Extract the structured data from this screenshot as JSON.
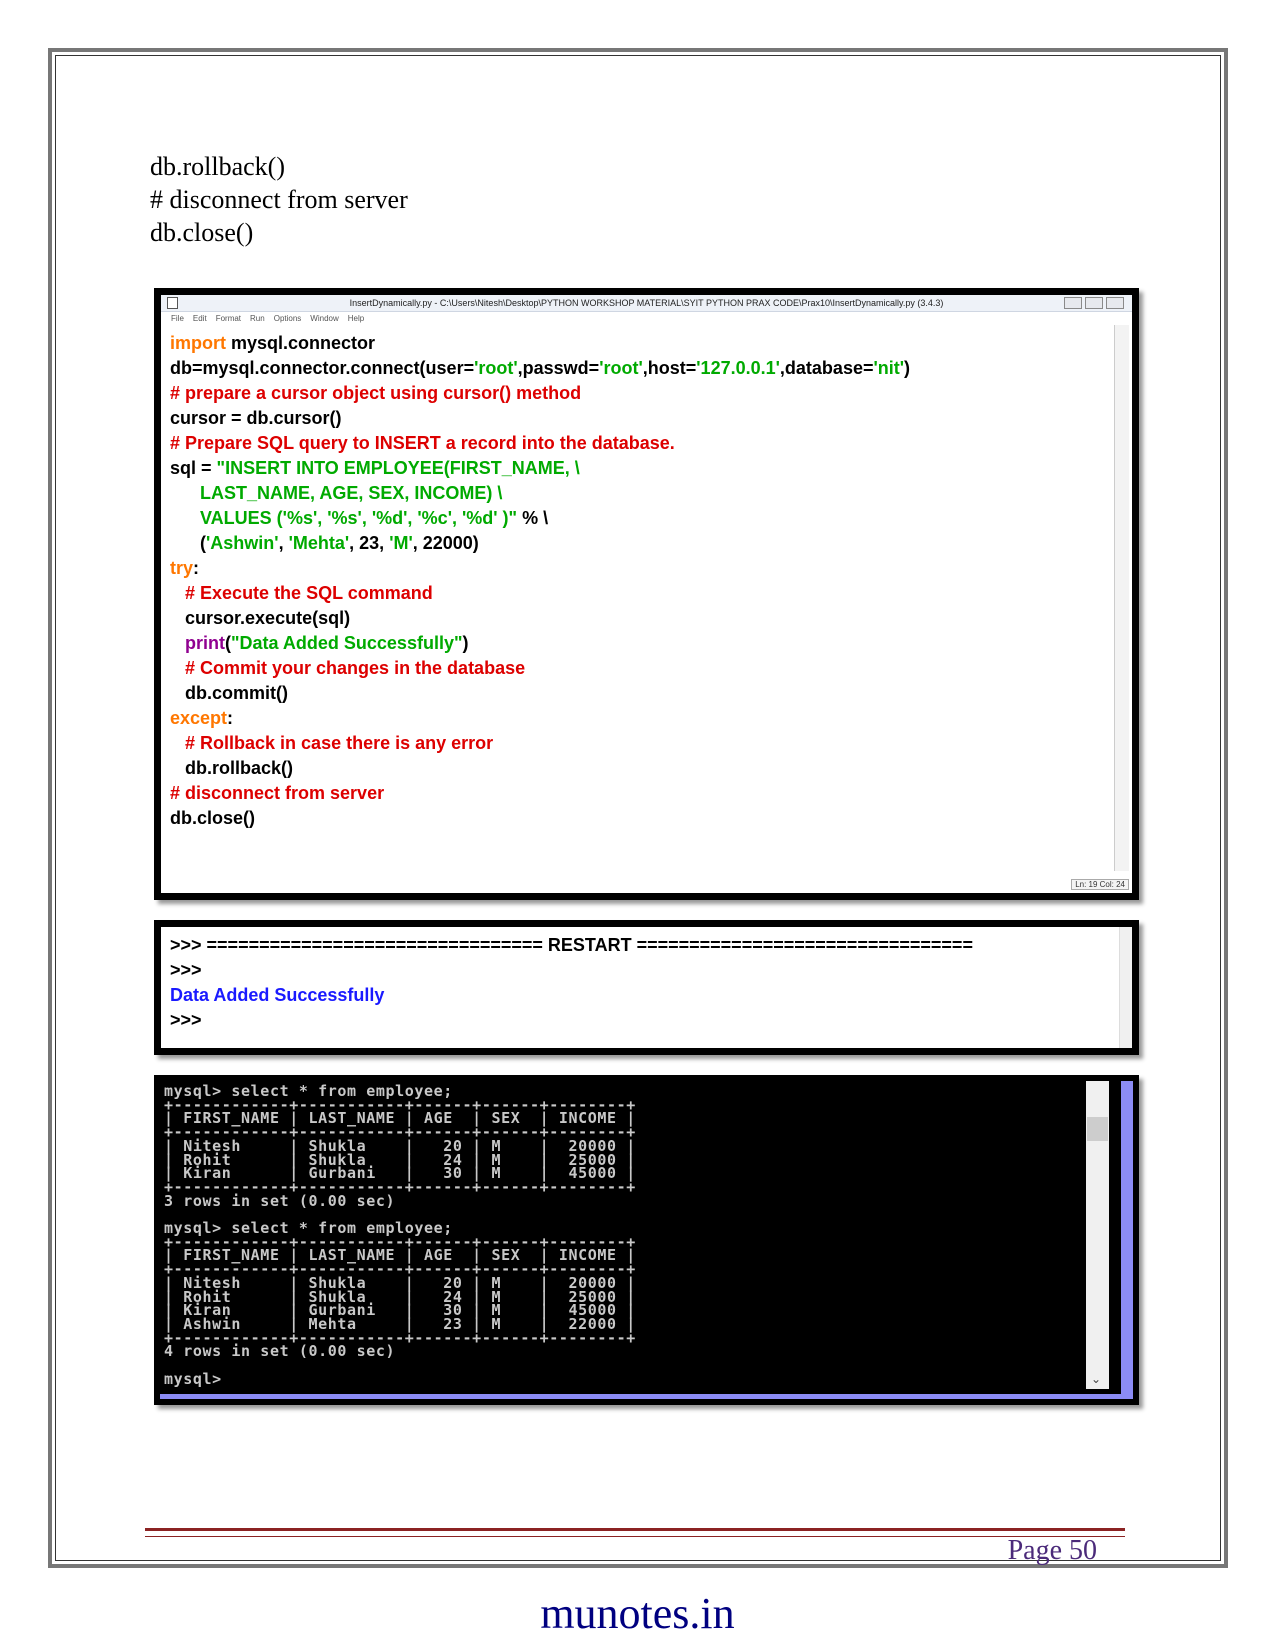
{
  "intro": {
    "line1": "db.rollback()",
    "line2": "# disconnect from server",
    "line3": "db.close()"
  },
  "editor": {
    "title": "InsertDynamically.py - C:\\Users\\Nitesh\\Desktop\\PYTHON WORKSHOP MATERIAL\\SYIT PYTHON PRAX CODE\\Prax10\\InsertDynamically.py (3.4.3)",
    "menu": [
      "File",
      "Edit",
      "Format",
      "Run",
      "Options",
      "Window",
      "Help"
    ],
    "status": "Ln: 19 Col: 24"
  },
  "shell": {
    "line1": ">>> ================================ RESTART ================================",
    "line2": ">>>",
    "line3": "Data Added Successfully",
    "line4": ">>>"
  },
  "console": {
    "lines": [
      "mysql> select * from employee;",
      "+------------+-----------+------+------+--------+",
      "| FIRST_NAME | LAST_NAME | AGE  | SEX  | INCOME |",
      "+------------+-----------+------+------+--------+",
      "| Nitesh     | Shukla    |   20 | M    |  20000 |",
      "| Rohit      | Shukla    |   24 | M    |  25000 |",
      "| Kiran      | Gurbani   |   30 | M    |  45000 |",
      "+------------+-----------+------+------+--------+",
      "3 rows in set (0.00 sec)",
      "",
      "mysql> select * from employee;",
      "+------------+-----------+------+------+--------+",
      "| FIRST_NAME | LAST_NAME | AGE  | SEX  | INCOME |",
      "+------------+-----------+------+------+--------+",
      "| Nitesh     | Shukla    |   20 | M    |  20000 |",
      "| Rohit      | Shukla    |   24 | M    |  25000 |",
      "| Kiran      | Gurbani   |   30 | M    |  45000 |",
      "| Ashwin     | Mehta     |   23 | M    |  22000 |",
      "+------------+-----------+------+------+--------+",
      "4 rows in set (0.00 sec)",
      "",
      "mysql>"
    ]
  },
  "footer": {
    "page": "Page 50",
    "site": "munotes.in"
  }
}
